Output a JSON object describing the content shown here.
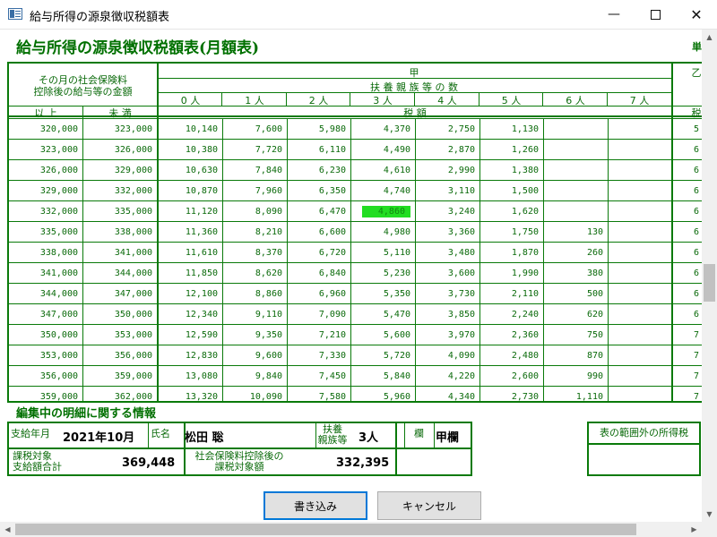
{
  "window": {
    "title": "給与所得の源泉徴収税額表",
    "min_glyph": "—",
    "close_glyph": "✕"
  },
  "page": {
    "title": "給与所得の源泉徴収税額表(月額表)",
    "title_right": "単"
  },
  "table": {
    "header": {
      "left_label_line1": "その月の社会保険料",
      "left_label_line2": "控除後の給与等の金額",
      "kou": "甲",
      "dependents": "扶 養 親 族 等 の 数",
      "persons": [
        "0 人",
        "1 人",
        "2 人",
        "3 人",
        "4 人",
        "5 人",
        "6 人",
        "7 人"
      ],
      "ijou": "以 上",
      "miman": "未 満",
      "zeigaku": "税 額",
      "otsu_partial": "乙",
      "otsu_zei_partial": "税"
    },
    "highlight": {
      "row": 4,
      "col": 3
    },
    "rows": [
      [
        "320,000",
        "323,000",
        "10,140",
        "7,600",
        "5,980",
        "4,370",
        "2,750",
        "1,130",
        "",
        "",
        "5"
      ],
      [
        "323,000",
        "326,000",
        "10,380",
        "7,720",
        "6,110",
        "4,490",
        "2,870",
        "1,260",
        "",
        "",
        "6"
      ],
      [
        "326,000",
        "329,000",
        "10,630",
        "7,840",
        "6,230",
        "4,610",
        "2,990",
        "1,380",
        "",
        "",
        "6"
      ],
      [
        "329,000",
        "332,000",
        "10,870",
        "7,960",
        "6,350",
        "4,740",
        "3,110",
        "1,500",
        "",
        "",
        "6"
      ],
      [
        "332,000",
        "335,000",
        "11,120",
        "8,090",
        "6,470",
        "4,860",
        "3,240",
        "1,620",
        "",
        "",
        "6"
      ],
      [
        "335,000",
        "338,000",
        "11,360",
        "8,210",
        "6,600",
        "4,980",
        "3,360",
        "1,750",
        "130",
        "",
        "6"
      ],
      [
        "338,000",
        "341,000",
        "11,610",
        "8,370",
        "6,720",
        "5,110",
        "3,480",
        "1,870",
        "260",
        "",
        "6"
      ],
      [
        "341,000",
        "344,000",
        "11,850",
        "8,620",
        "6,840",
        "5,230",
        "3,600",
        "1,990",
        "380",
        "",
        "6"
      ],
      [
        "344,000",
        "347,000",
        "12,100",
        "8,860",
        "6,960",
        "5,350",
        "3,730",
        "2,110",
        "500",
        "",
        "6"
      ],
      [
        "347,000",
        "350,000",
        "12,340",
        "9,110",
        "7,090",
        "5,470",
        "3,850",
        "2,240",
        "620",
        "",
        "6"
      ],
      [
        "350,000",
        "353,000",
        "12,590",
        "9,350",
        "7,210",
        "5,600",
        "3,970",
        "2,360",
        "750",
        "",
        "7"
      ],
      [
        "353,000",
        "356,000",
        "12,830",
        "9,600",
        "7,330",
        "5,720",
        "4,090",
        "2,480",
        "870",
        "",
        "7"
      ],
      [
        "356,000",
        "359,000",
        "13,080",
        "9,840",
        "7,450",
        "5,840",
        "4,220",
        "2,600",
        "990",
        "",
        "7"
      ],
      [
        "359,000",
        "362,000",
        "13,320",
        "10,090",
        "7,580",
        "5,960",
        "4,340",
        "2,730",
        "1,110",
        "",
        "7"
      ]
    ]
  },
  "edit": {
    "title": "編集中の明細に関する情報",
    "pay_month_label": "支給年月",
    "pay_month_value": "2021年10月",
    "name_label": "氏名",
    "name_value": "松田 聡",
    "dependents_label_line1": "扶養",
    "dependents_label_line2": "親族等",
    "dependents_value": "3人",
    "column_label": "欄",
    "column_value": "甲欄",
    "taxable_label_line1": "課税対象",
    "taxable_label_line2": "支給額合計",
    "taxable_value": "369,448",
    "after_label_line1": "社会保険料控除後の",
    "after_label_line2": "課税対象額",
    "after_value": "332,395",
    "out_of_range_label": "表の範囲外の所得税"
  },
  "buttons": {
    "write": "書き込み",
    "cancel": "キャンセル"
  },
  "scroll": {
    "up": "▲",
    "down": "▼",
    "left": "◀",
    "right": "▶"
  }
}
